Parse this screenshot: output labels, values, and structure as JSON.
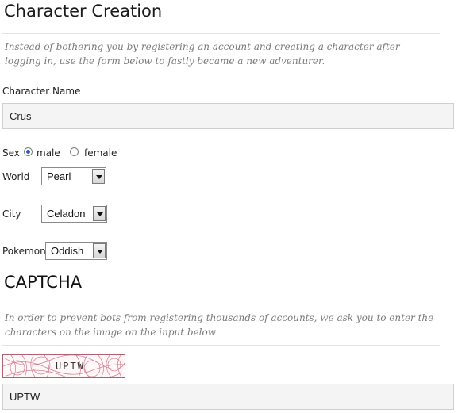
{
  "form": {
    "title": "Character Creation",
    "intro": "Instead of bothering you by registering an account and creating a character after logging in, use the form below to fastly became a new adventurer.",
    "name_label": "Character Name",
    "name_value": "Crus",
    "sex_label": "Sex",
    "sex_options": [
      "male",
      "female"
    ],
    "sex_selected": "male",
    "world_label": "World",
    "world_value": "Pearl",
    "city_label": "City",
    "city_value": "Celadon",
    "pokemon_label": "Pokemon",
    "pokemon_value": "Oddish"
  },
  "captcha": {
    "title": "CAPTCHA",
    "description": "In order to prevent bots from registering thousands of accounts, we ask you to enter the characters on the image on the input below",
    "image_text": "UPTW",
    "input_value": "UPTW"
  },
  "colors": {
    "radio_selected": "#2b5fb5",
    "captcha_lines": "#c5566a"
  }
}
